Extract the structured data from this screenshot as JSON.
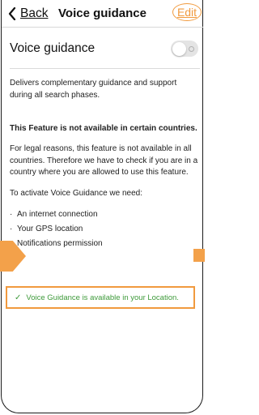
{
  "header": {
    "back_label": "Back",
    "title": "Voice guidance",
    "edit_label": "Edit"
  },
  "setting": {
    "label": "Voice guidance",
    "enabled": false
  },
  "content": {
    "description": "Delivers complementary guidance and support during all search phases.",
    "notice": "This Feature is not available in certain countries.",
    "legal": "For legal reasons, this feature is not available in all countries. Therefore we have to check if you are in a country where you are allowed to use this feature.",
    "activate_intro": "To activate Voice Guidance we need:",
    "requirements": [
      {
        "label": "An internet connection"
      },
      {
        "label": "Your GPS location"
      },
      {
        "label": "Notifications permission"
      }
    ],
    "bullet": "·"
  },
  "status": {
    "check": "✓",
    "message": "Voice Guidance is available in your Location."
  },
  "colors": {
    "accent_orange": "#f19a3e",
    "success_green": "#3e9a3a"
  }
}
